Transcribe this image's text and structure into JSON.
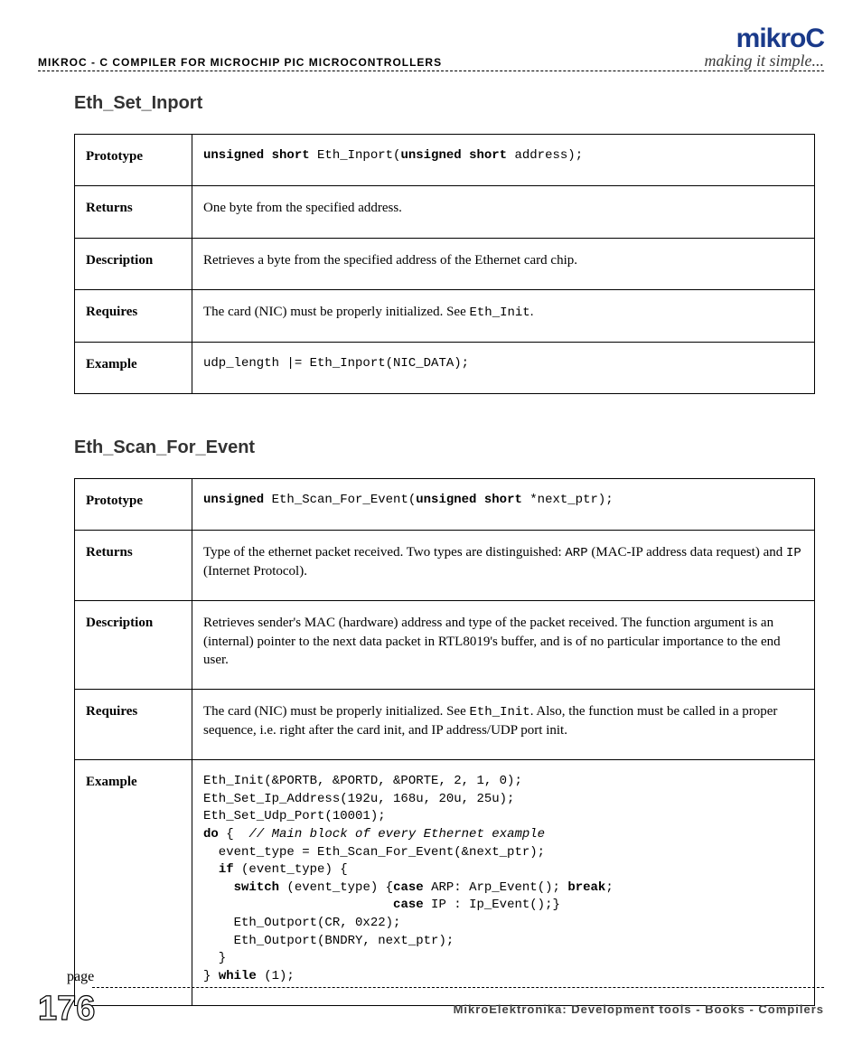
{
  "header": {
    "left": "mikroC - C Compiler for Microchip PIC microcontrollers",
    "brand": "mikroC",
    "tagline": "making it simple..."
  },
  "sections": [
    {
      "title": "Eth_Set_Inport",
      "rows": {
        "prototype_label": "Prototype",
        "prototype_html": "<b>unsigned short</b> Eth_Inport(<b>unsigned short</b> address);",
        "returns_label": "Returns",
        "returns_text": "One byte from the specified address.",
        "description_label": "Description",
        "description_text": "Retrieves a byte from the specified address of the Ethernet card chip.",
        "requires_label": "Requires",
        "requires_html": "The card (NIC) must be properly initialized. See <span class=\"mono\">Eth_Init</span>.",
        "example_label": "Example",
        "example_code": "udp_length |= Eth_Inport(NIC_DATA);"
      }
    },
    {
      "title": "Eth_Scan_For_Event",
      "rows": {
        "prototype_label": "Prototype",
        "prototype_html": "<b>unsigned</b> Eth_Scan_For_Event(<b>unsigned short</b> *next_ptr);",
        "returns_label": "Returns",
        "returns_html": "Type of the ethernet packet received. Two types are distinguished: <span class=\"mono\">ARP</span> (MAC-IP address data request) and <span class=\"mono\">IP</span> (Internet Protocol).",
        "description_label": "Description",
        "description_text": "Retrieves sender's MAC (hardware) address and type of the packet received. The function argument is an (internal) pointer to the next data packet in RTL8019's buffer, and is of no particular importance to the end user.",
        "requires_label": "Requires",
        "requires_html": "The card (NIC) must be properly initialized. See <span class=\"mono\">Eth_Init</span>. Also, the function must be called in a proper sequence, i.e. right after the card init, and IP address/UDP port init.",
        "example_label": "Example",
        "example_code": "Eth_Init(&PORTB, &PORTD, &PORTE, 2, 1, 0);\nEth_Set_Ip_Address(192u, 168u, 20u, 25u);\nEth_Set_Udp_Port(10001);\n<b>do</b> {  <i>// Main block of every Ethernet example</i>\n  event_type = Eth_Scan_For_Event(&next_ptr);\n  <b>if</b> (event_type) {\n    <b>switch</b> (event_type) {<b>case</b> ARP: Arp_Event(); <b>break</b>;\n                         <b>case</b> IP : Ip_Event();}\n    Eth_Outport(CR, 0x22);\n    Eth_Outport(BNDRY, next_ptr);\n  }\n} <b>while</b> (1);"
      }
    }
  ],
  "footer": {
    "page_label": "page",
    "page_number": "176",
    "text": "MikroElektronika: Development tools - Books - Compilers"
  }
}
